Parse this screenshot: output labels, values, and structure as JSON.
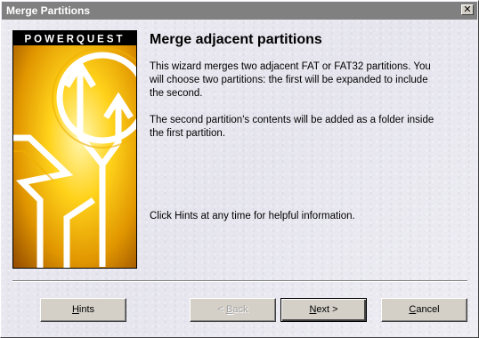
{
  "window": {
    "title": "Merge Partitions",
    "close_glyph": "✕"
  },
  "banner": {
    "brand_text": "POWERQUEST"
  },
  "main": {
    "heading": "Merge adjacent partitions",
    "paragraph1_line1": "This wizard merges two adjacent FAT or FAT32 partitions.  You",
    "paragraph1_line2": "will choose two partitions: the first will be expanded to include",
    "paragraph1_line3": "the second.",
    "paragraph2_line1": "The second partition's contents will be added as a folder inside",
    "paragraph2_line2": "the first partition.",
    "hint_text": "Click Hints at any time for helpful information."
  },
  "buttons": {
    "hints": {
      "mnemonic": "H",
      "rest": "ints"
    },
    "back": {
      "prefix": "< ",
      "mnemonic": "B",
      "rest": "ack"
    },
    "next": {
      "mnemonic": "N",
      "rest": "ext >"
    },
    "cancel": {
      "mnemonic": "C",
      "rest": "ancel"
    }
  }
}
